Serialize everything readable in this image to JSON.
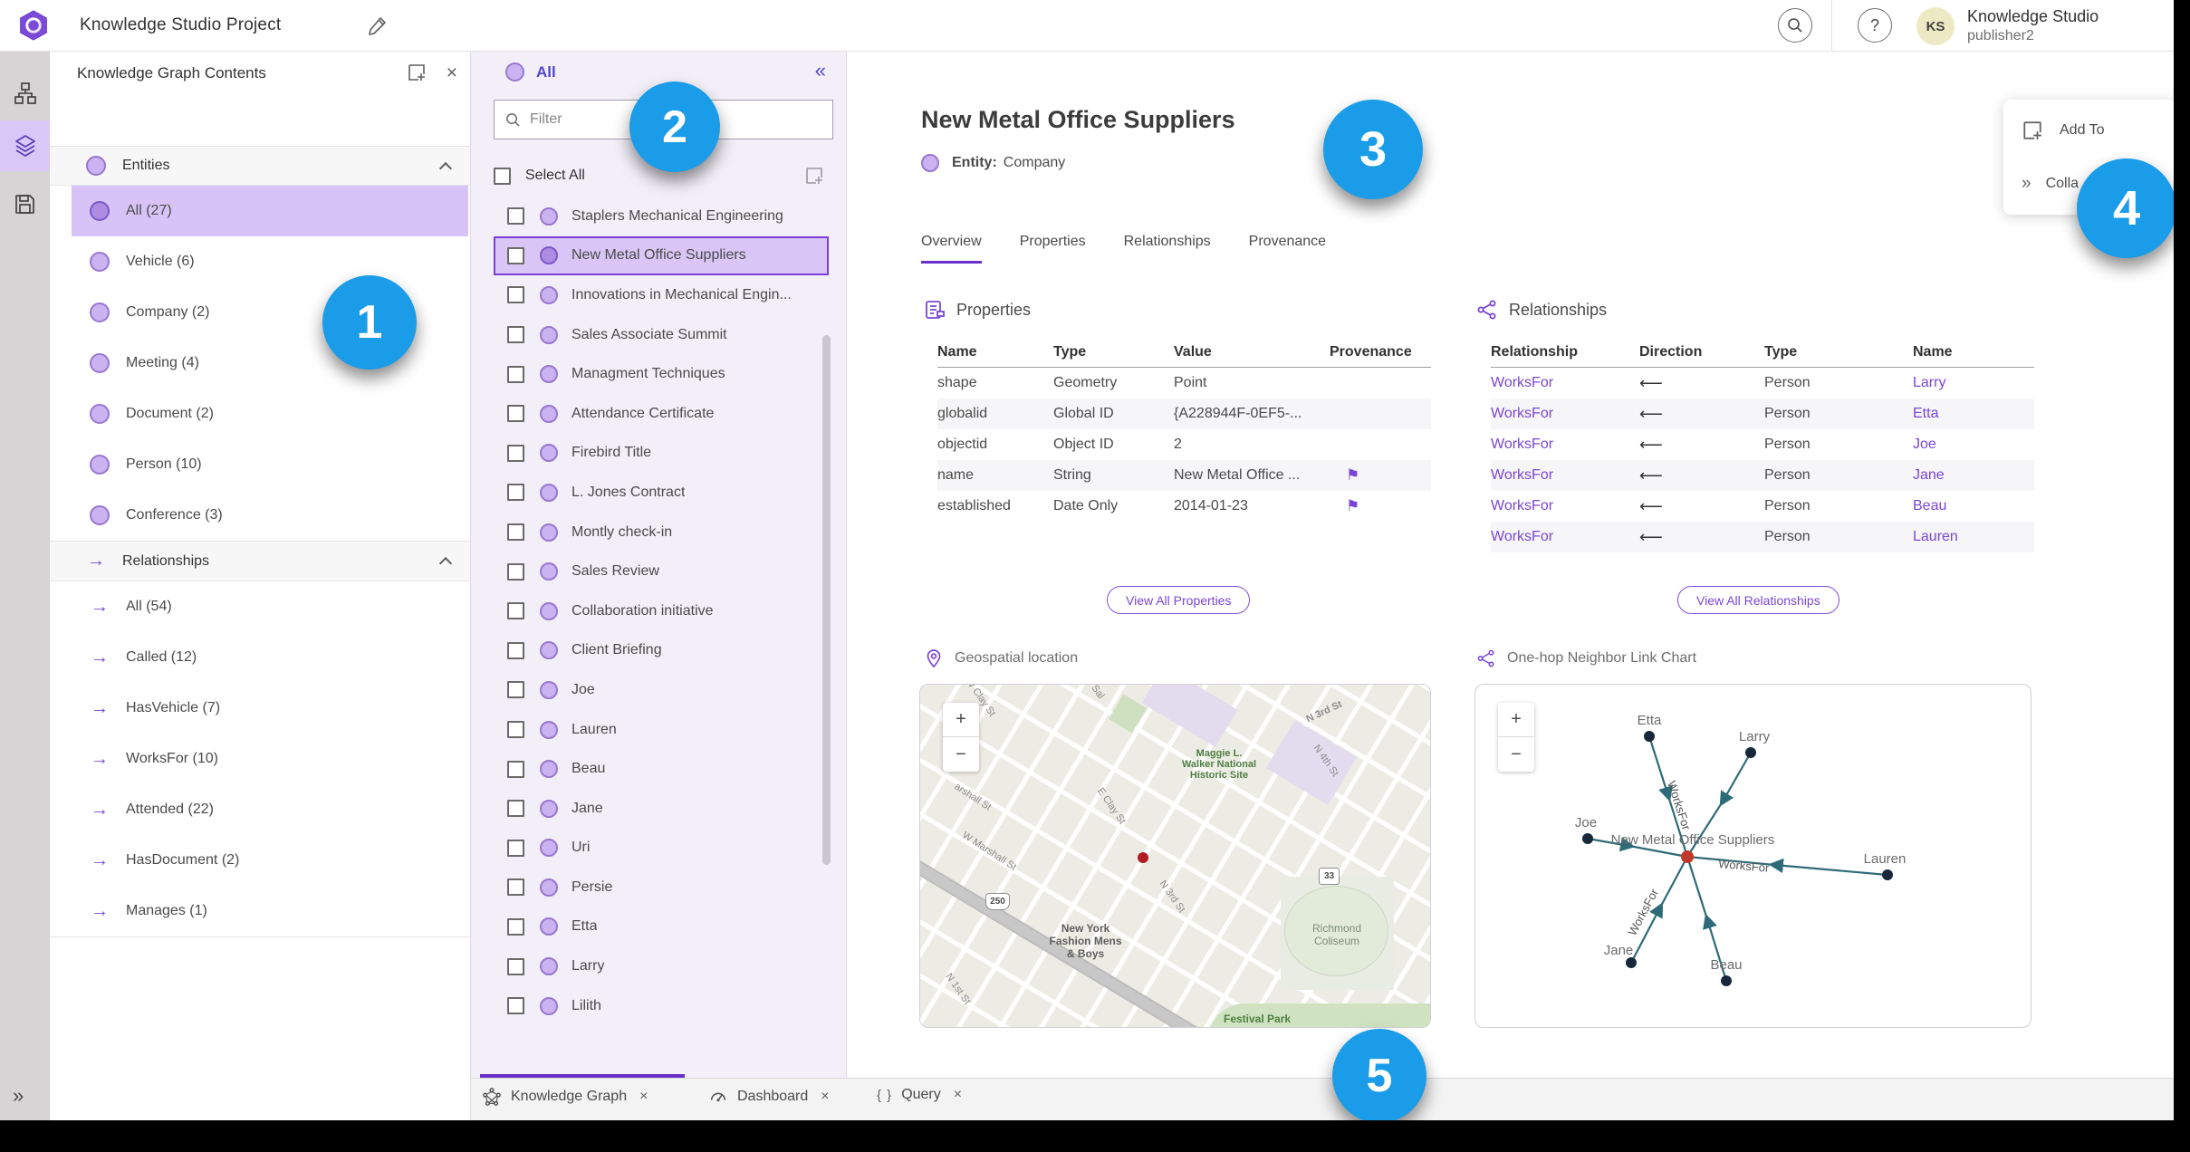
{
  "header": {
    "title": "Knowledge Studio Project",
    "user_name": "Knowledge Studio",
    "user_role": "publisher2",
    "avatar_initials": "KS",
    "help_glyph": "?"
  },
  "contents_panel": {
    "title": "Knowledge Graph Contents",
    "entities": {
      "label": "Entities",
      "items": [
        {
          "label": "All (27)",
          "cls": "selected"
        },
        {
          "label": "Vehicle (6)"
        },
        {
          "label": "Company (2)"
        },
        {
          "label": "Meeting (4)"
        },
        {
          "label": "Document (2)"
        },
        {
          "label": "Person (10)"
        },
        {
          "label": "Conference (3)"
        }
      ]
    },
    "relationships": {
      "label": "Relationships",
      "arrow_glyph": "→",
      "items": [
        {
          "label": "All (54)"
        },
        {
          "label": "Called (12)"
        },
        {
          "label": "HasVehicle (7)"
        },
        {
          "label": "WorksFor (10)"
        },
        {
          "label": "Attended (22)"
        },
        {
          "label": "HasDocument (2)"
        },
        {
          "label": "Manages (1)"
        }
      ]
    }
  },
  "list_panel": {
    "header": "All",
    "collapse_glyph": "«",
    "filter_placeholder": "Filter",
    "select_all": "Select All",
    "items": [
      {
        "label": "Staplers Mechanical Engineering"
      },
      {
        "label": "New Metal Office Suppliers",
        "cls": "selected"
      },
      {
        "label": "Innovations in Mechanical Engin..."
      },
      {
        "label": "Sales Associate Summit"
      },
      {
        "label": "Managment Techniques"
      },
      {
        "label": "Attendance Certificate"
      },
      {
        "label": "Firebird Title"
      },
      {
        "label": "L. Jones Contract"
      },
      {
        "label": "Montly check-in"
      },
      {
        "label": "Sales Review"
      },
      {
        "label": "Collaboration initiative"
      },
      {
        "label": "Client Briefing"
      },
      {
        "label": "Joe"
      },
      {
        "label": "Lauren"
      },
      {
        "label": "Beau"
      },
      {
        "label": "Jane"
      },
      {
        "label": "Uri"
      },
      {
        "label": "Persie"
      },
      {
        "label": "Etta"
      },
      {
        "label": "Larry"
      },
      {
        "label": "Lilith"
      }
    ]
  },
  "detail": {
    "title": "New Metal Office Suppliers",
    "entity_key": "Entity:",
    "entity_value": "Company",
    "tabs": [
      {
        "label": "Overview",
        "cls": "active"
      },
      {
        "label": "Properties"
      },
      {
        "label": "Relationships"
      },
      {
        "label": "Provenance"
      }
    ],
    "properties": {
      "title": "Properties",
      "col_name": "Name",
      "col_type": "Type",
      "col_value": "Value",
      "col_prov": "Provenance",
      "rows": [
        {
          "name": "shape",
          "type": "Geometry",
          "value": "Point",
          "prov": ""
        },
        {
          "name": "globalid",
          "type": "Global ID",
          "value": "{A228944F-0EF5-...",
          "prov": ""
        },
        {
          "name": "objectid",
          "type": "Object ID",
          "value": "2",
          "prov": ""
        },
        {
          "name": "name",
          "type": "String",
          "value": "New Metal Office ...",
          "prov": "⚑"
        },
        {
          "name": "established",
          "type": "Date Only",
          "value": "2014-01-23",
          "prov": "⚑"
        }
      ],
      "view_all": "View All Properties"
    },
    "relationships": {
      "title": "Relationships",
      "col_rel": "Relationship",
      "col_dir": "Direction",
      "col_type": "Type",
      "col_name": "Name",
      "rows": [
        {
          "rel": "WorksFor",
          "dir": "⟵",
          "type": "Person",
          "name": "Larry"
        },
        {
          "rel": "WorksFor",
          "dir": "⟵",
          "type": "Person",
          "name": "Etta"
        },
        {
          "rel": "WorksFor",
          "dir": "⟵",
          "type": "Person",
          "name": "Joe"
        },
        {
          "rel": "WorksFor",
          "dir": "⟵",
          "type": "Person",
          "name": "Jane"
        },
        {
          "rel": "WorksFor",
          "dir": "⟵",
          "type": "Person",
          "name": "Beau"
        },
        {
          "rel": "WorksFor",
          "dir": "⟵",
          "type": "Person",
          "name": "Lauren"
        }
      ],
      "view_all": "View All Relationships"
    },
    "map": {
      "title": "Geospatial location",
      "zoom_in": "+",
      "zoom_out": "−",
      "shield_250": "250",
      "shield_33": "33",
      "labels": {
        "w_clay": "W Clay St",
        "sal": "Sal",
        "n3rd_top": "N 3rd St",
        "n4th": "N 4th St",
        "maggie": "Maggie L.\nWalker National\nHistoric Site",
        "marshall_a": "arshall St",
        "w_marshall": "W Marshall St",
        "e_clay": "E Clay St",
        "n3rd_mid": "N 3rd St",
        "ny_fashion": "New York\nFashion Mens\n& Boys",
        "richmond": "Richmond\nColiseum",
        "n1st": "N 1st St",
        "festival": "Festival Park"
      }
    },
    "graph": {
      "title": "One-hop Neighbor Link Chart",
      "zoom_in": "+",
      "zoom_out": "−",
      "center_label": "New Metal Office Suppliers",
      "edge_label": "WorksFor",
      "nodes": [
        "Etta",
        "Larry",
        "Joe",
        "Lauren",
        "Jane",
        "Beau"
      ]
    }
  },
  "add_menu": {
    "add_to": "Add To",
    "collapse_partial": "Colla",
    "collapse_glyph": "»"
  },
  "bottom_tabs": {
    "t1": "Knowledge Graph",
    "t2": "Dashboard",
    "t3": "Query",
    "close_glyph": "×",
    "query_icon": "{ }"
  },
  "callouts": {
    "c1": "1",
    "c2": "2",
    "c3": "3",
    "c4": "4",
    "c5": "5"
  }
}
